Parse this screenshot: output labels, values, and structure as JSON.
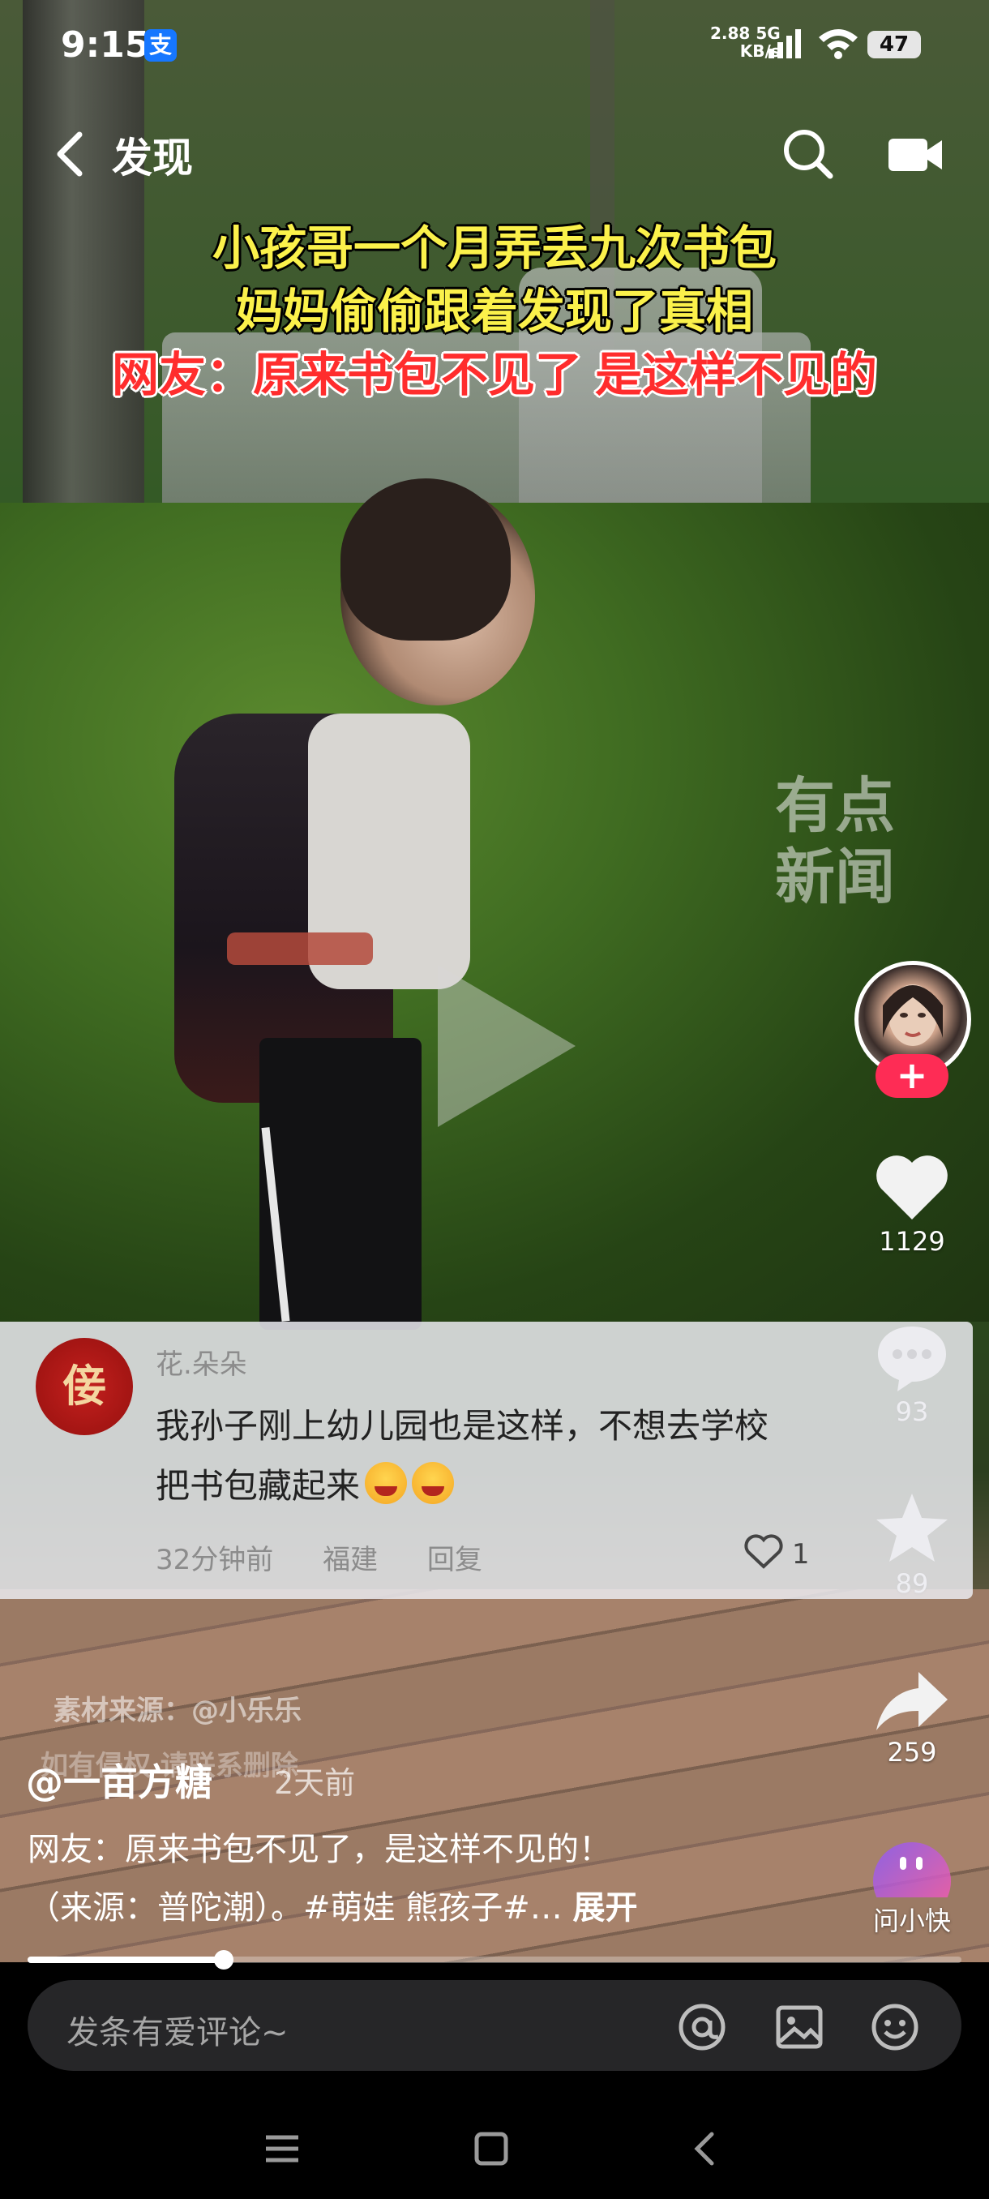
{
  "status_bar": {
    "time": "9:15",
    "alipay_icon": "支",
    "net_speed_value": "2.88",
    "net_speed_unit": "KB/s",
    "network": "5G",
    "battery": "47"
  },
  "nav": {
    "back_label": "发现"
  },
  "video": {
    "headline_line1": "小孩哥一个月弄丢九次书包",
    "headline_line2": "妈妈偷偷跟着发现了真相",
    "headline_line3": "网友：原来书包不见了 是这样不见的",
    "watermark_line1": "有点",
    "watermark_line2": "新闻",
    "source_line1": "素材来源：@小乐乐",
    "source_line2": "如有侵权 请联系删除"
  },
  "right_rail": {
    "like_count": "1129",
    "comment_count": "93",
    "favorite_count": "89",
    "share_count": "259",
    "ask_label": "问小快"
  },
  "comment": {
    "avatar_char": "倿",
    "name": "花.朵朵",
    "text_line1": "我孙子刚上幼儿园也是这样，不想去学校",
    "text_line2": "把书包藏起来",
    "time": "32分钟前",
    "location": "福建",
    "reply_label": "回复",
    "like_count": "1"
  },
  "post": {
    "author": "@一亩方糖",
    "time": "2天前",
    "caption_line1": "网友：原来书包不见了，是这样不见的！",
    "caption_line2": "（来源：普陀潮）。#萌娃 熊孩子#…",
    "expand_label": "展开",
    "progress": 0.21
  },
  "comment_input": {
    "placeholder": "发条有爱评论~"
  },
  "colors": {
    "follow_accent": "#fe2c55",
    "headline_yellow": "#fbf14b",
    "headline_red": "#ff2d2d"
  },
  "icons": [
    "back-icon",
    "search-icon",
    "video-icon",
    "heart-icon",
    "comment-icon",
    "star-icon",
    "share-icon",
    "at-icon",
    "image-icon",
    "emoji-icon",
    "menu-icon",
    "home-icon",
    "back-nav-icon"
  ]
}
